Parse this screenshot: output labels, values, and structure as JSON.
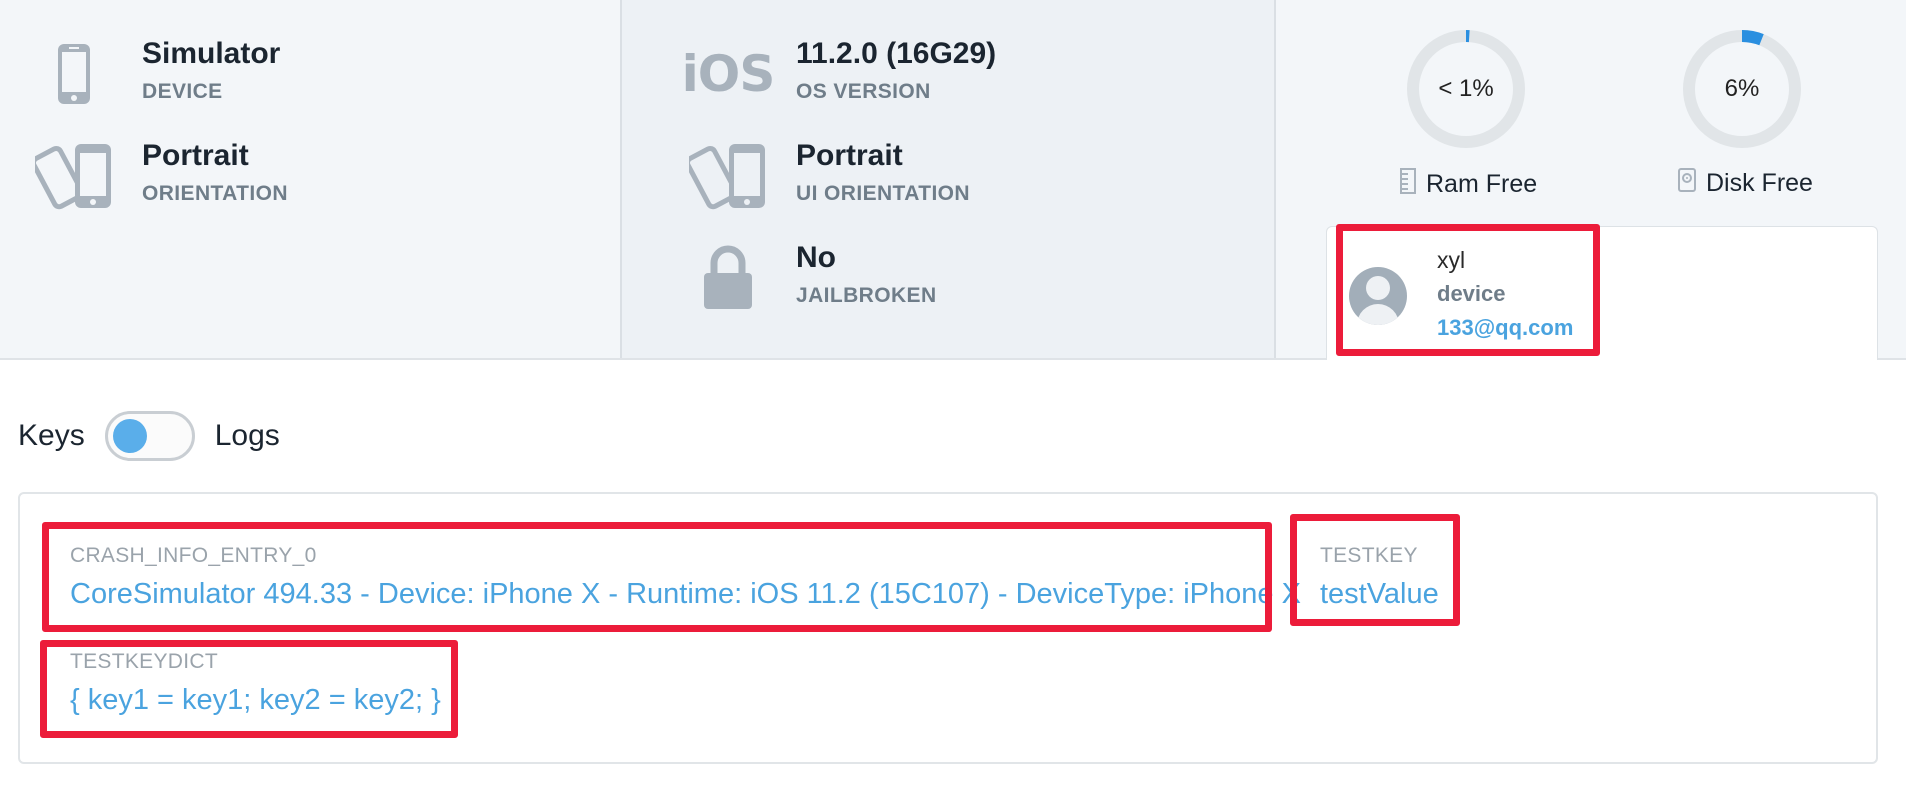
{
  "device_panel": {
    "device": {
      "value": "Simulator",
      "label": "DEVICE",
      "icon": "phone-icon"
    },
    "orientation": {
      "value": "Portrait",
      "label": "ORIENTATION",
      "icon": "rotate-device-icon"
    }
  },
  "os_panel": {
    "os": {
      "icon_text": "iOS",
      "value": "11.2.0 (16G29)",
      "label": "OS VERSION"
    },
    "ui_orientation": {
      "value": "Portrait",
      "label": "UI ORIENTATION",
      "icon": "rotate-device-icon"
    },
    "jailbroken": {
      "value": "No",
      "label": "JAILBROKEN",
      "icon": "lock-icon"
    }
  },
  "resources_panel": {
    "ram": {
      "value_text": "< 1%",
      "fraction": 0.01,
      "caption": "Ram Free",
      "icon": "memory-icon"
    },
    "disk": {
      "value_text": "6%",
      "fraction": 0.06,
      "caption": "Disk Free",
      "icon": "disk-icon"
    }
  },
  "user": {
    "name": "xyl",
    "role": "device",
    "email": "133@qq.com",
    "icon": "avatar-icon"
  },
  "view_toggle": {
    "left_label": "Keys",
    "right_label": "Logs",
    "state": "keys"
  },
  "keys": [
    {
      "key": "CRASH_INFO_ENTRY_0",
      "value": "CoreSimulator 494.33 - Device: iPhone X - Runtime: iOS 11.2 (15C107) - DeviceType: iPhone X"
    },
    {
      "key": "TESTKEY",
      "value": "testValue"
    },
    {
      "key": "TESTKEYDICT",
      "value": "{ key1 = key1; key2 = key2; }"
    }
  ],
  "colors": {
    "accent": "#4aa3df",
    "highlight": "#ec1c3a",
    "gauge_track": "#e1e5e8",
    "gauge_fill": "#2a8fe0"
  }
}
